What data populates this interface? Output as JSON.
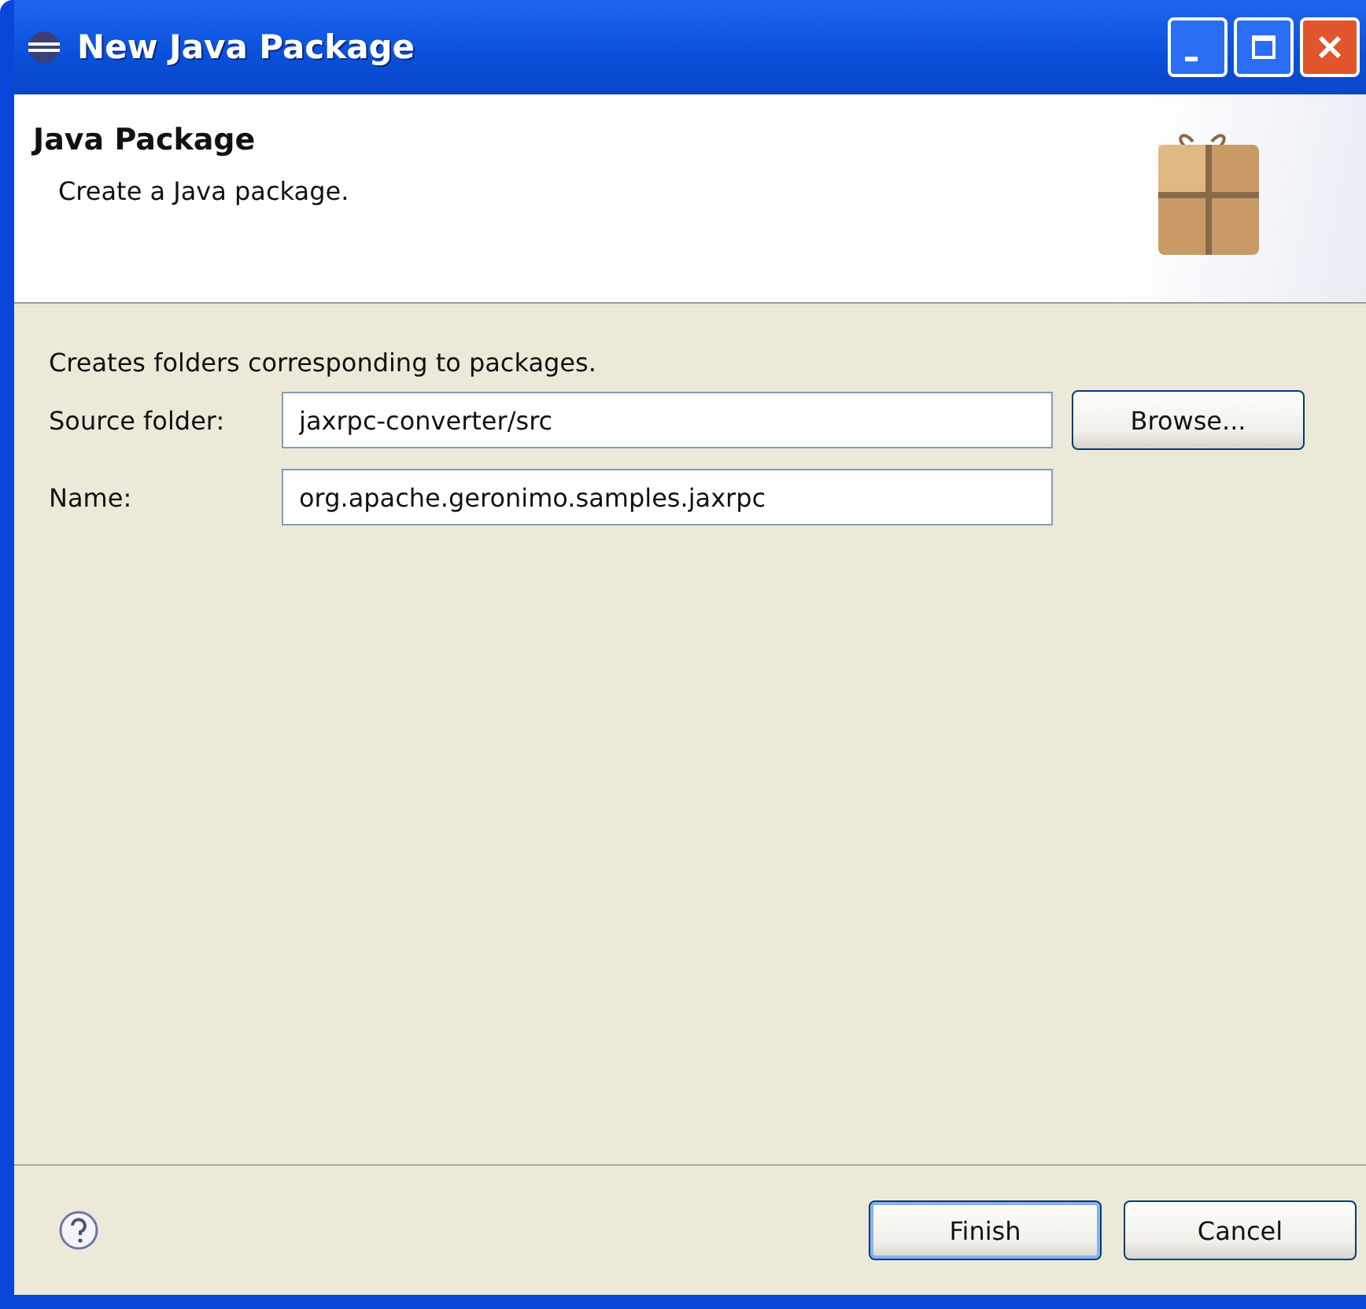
{
  "window": {
    "title": "New Java Package"
  },
  "header": {
    "title": "Java Package",
    "description": "Create a Java package."
  },
  "body": {
    "intro": "Creates folders corresponding to packages.",
    "fields": [
      {
        "label": "Source folder:",
        "value": "jaxrpc-converter/src",
        "button": "Browse..."
      },
      {
        "label": "Name:",
        "value": "org.apache.geronimo.samples.jaxrpc"
      }
    ]
  },
  "buttons": [
    {
      "label": "Finish",
      "default": true
    },
    {
      "label": "Cancel",
      "default": false
    }
  ]
}
